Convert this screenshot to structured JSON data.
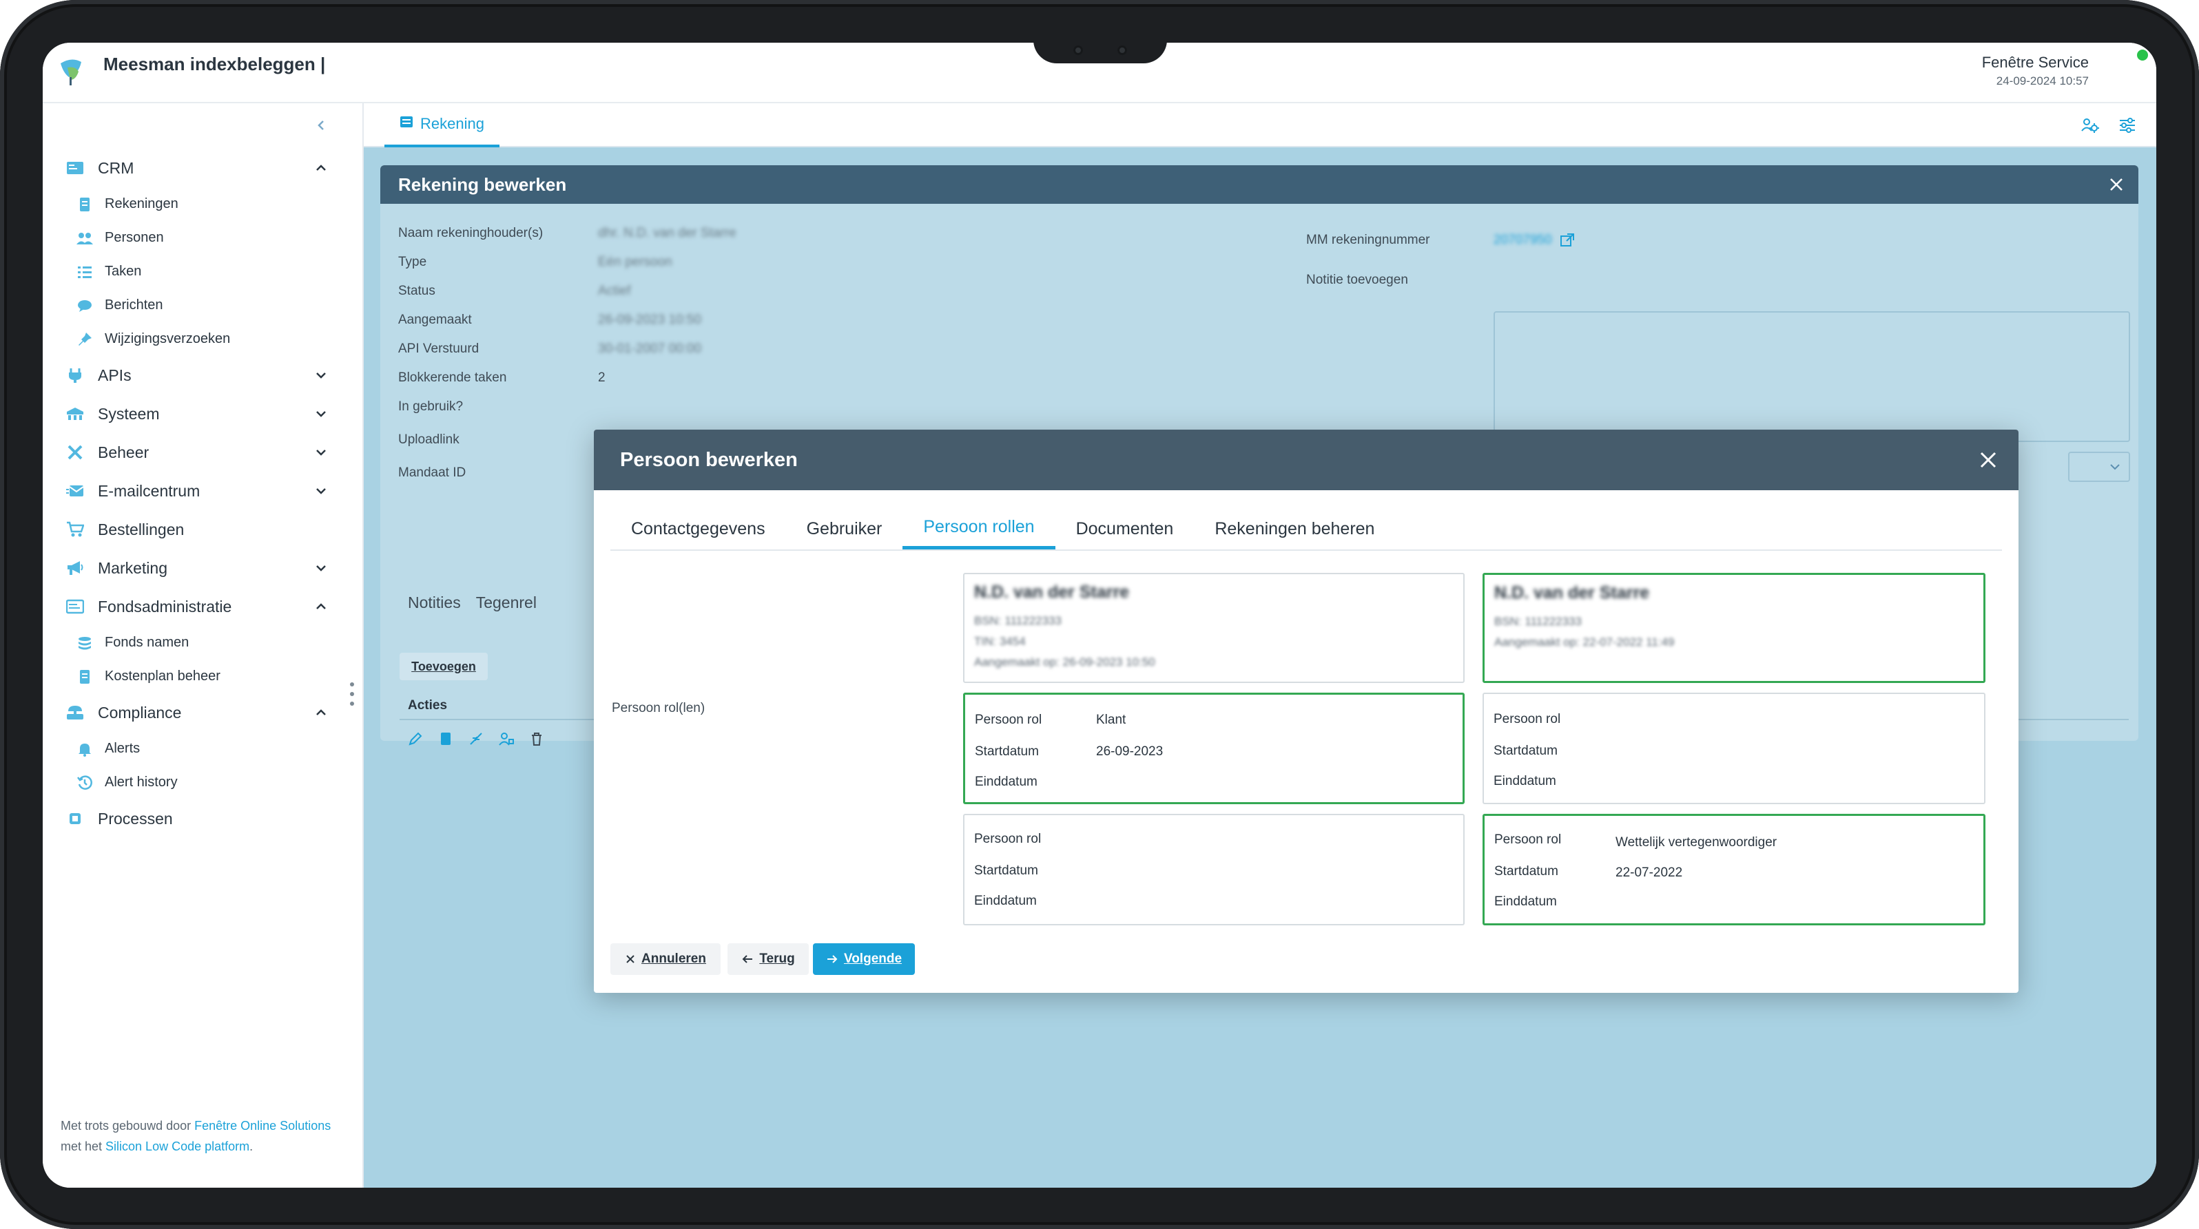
{
  "app": {
    "title": "Meesman indexbeleggen |"
  },
  "user": {
    "name": "Fenêtre Service",
    "datetime": "24-09-2024 10:57"
  },
  "colors": {
    "accent": "#1ba1d8",
    "header_dark": "#465c6c",
    "panel_dark": "#3e6077",
    "active_border": "#34a853",
    "status_online": "#29c24a"
  },
  "sidebar": {
    "sections": [
      {
        "label": "CRM",
        "icon": "crm-icon",
        "expanded": true,
        "children": [
          {
            "label": "Rekeningen",
            "icon": "document-icon"
          },
          {
            "label": "Personen",
            "icon": "people-icon"
          },
          {
            "label": "Taken",
            "icon": "tasks-icon"
          },
          {
            "label": "Berichten",
            "icon": "chat-icon"
          },
          {
            "label": "Wijzigingsverzoeken",
            "icon": "pin-icon"
          }
        ]
      },
      {
        "label": "APIs",
        "icon": "api-icon",
        "expanded": false
      },
      {
        "label": "Systeem",
        "icon": "system-icon",
        "expanded": false
      },
      {
        "label": "Beheer",
        "icon": "tools-icon",
        "expanded": false
      },
      {
        "label": "E-mailcentrum",
        "icon": "email-icon",
        "expanded": false
      },
      {
        "label": "Bestellingen",
        "icon": "cart-icon"
      },
      {
        "label": "Marketing",
        "icon": "megaphone-icon",
        "expanded": false
      },
      {
        "label": "Fondsadministratie",
        "icon": "fund-icon",
        "expanded": true,
        "children": [
          {
            "label": "Fonds namen",
            "icon": "stack-icon"
          },
          {
            "label": "Kostenplan beheer",
            "icon": "document-icon"
          }
        ]
      },
      {
        "label": "Compliance",
        "icon": "compliance-icon",
        "expanded": true,
        "children": [
          {
            "label": "Alerts",
            "icon": "bell-icon"
          },
          {
            "label": "Alert history",
            "icon": "history-icon"
          }
        ]
      },
      {
        "label": "Processen",
        "icon": "process-icon"
      }
    ],
    "footer": {
      "prefix": "Met trots gebouwd door ",
      "link1": "Fenêtre Online Solutions",
      "middle": " met het ",
      "link2": "Silicon Low Code platform",
      "suffix": "."
    }
  },
  "main": {
    "tab": "Rekening",
    "panel": {
      "title": "Rekening bewerken",
      "fields": [
        {
          "label": "Naam rekeninghouder(s)",
          "value": "dhr. N.D. van der Starre"
        },
        {
          "label": "Type",
          "value": "Eén persoon"
        },
        {
          "label": "Status",
          "value": "Actief"
        },
        {
          "label": "Aangemaakt",
          "value": "26-09-2023 10:50"
        },
        {
          "label": "API Verstuurd",
          "value": "30-01-2007 00:00"
        },
        {
          "label": "Blokkerende taken",
          "value": "2"
        },
        {
          "label": "In gebruik?",
          "value": ""
        },
        {
          "label": "Uploadlink",
          "value": ""
        },
        {
          "label": "Mandaat ID",
          "value": ""
        }
      ],
      "account_number_label": "MM rekeningnummer",
      "account_number_value": "20707950",
      "note_label": "Notitie toevoegen",
      "sub_tabs": [
        "Notities",
        "Tegenrel"
      ],
      "add_button": "Toevoegen",
      "actions_header": "Acties"
    }
  },
  "modal": {
    "title": "Persoon bewerken",
    "tabs": [
      "Contactgegevens",
      "Gebruiker",
      "Persoon rollen",
      "Documenten",
      "Rekeningen beheren"
    ],
    "active_tab": "Persoon rollen",
    "row_label": "Persoon rol(len)",
    "persons": [
      {
        "name": "N.D. van der Starre",
        "meta": [
          "BSN: 111222333",
          "TIN: 3454",
          "Aangemaakt op: 26-09-2023 10:50"
        ]
      },
      {
        "name": "N.D. van der Starre",
        "meta": [
          "BSN: 111222333",
          "Aangemaakt op: 22-07-2022 11:49"
        ]
      }
    ],
    "field_labels": {
      "role": "Persoon rol",
      "start": "Startdatum",
      "end": "Einddatum"
    },
    "roles": [
      {
        "role": "Klant",
        "start": "26-09-2023",
        "end": ""
      },
      {
        "role": "",
        "start": "",
        "end": ""
      },
      {
        "role": "",
        "start": "",
        "end": ""
      },
      {
        "role": "Wettelijk vertegenwoordiger",
        "start": "22-07-2022",
        "end": ""
      }
    ],
    "buttons": {
      "cancel": "Annuleren",
      "back": "Terug",
      "next": "Volgende"
    }
  }
}
